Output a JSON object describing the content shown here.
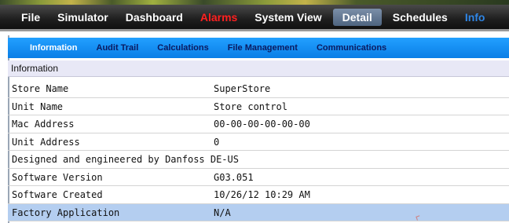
{
  "menu": {
    "items": [
      {
        "label": "File"
      },
      {
        "label": "Simulator"
      },
      {
        "label": "Dashboard"
      },
      {
        "label": "Alarms"
      },
      {
        "label": "System View"
      },
      {
        "label": "Detail"
      },
      {
        "label": "Schedules"
      },
      {
        "label": "Info"
      }
    ],
    "active": "Detail",
    "alarm_color": "#ff2020"
  },
  "subtabs": {
    "items": [
      {
        "label": "Information"
      },
      {
        "label": "Audit Trail"
      },
      {
        "label": "Calculations"
      },
      {
        "label": "File Management"
      },
      {
        "label": "Communications"
      }
    ],
    "active": "Information"
  },
  "section": {
    "title": "Information"
  },
  "rows": [
    {
      "label": "Store Name",
      "value": "SuperStore"
    },
    {
      "label": "Unit Name",
      "value": "Store control"
    },
    {
      "label": "Mac Address",
      "value": "00-00-00-00-00-00"
    },
    {
      "label": "Unit Address",
      "value": "0"
    },
    {
      "label": "Designed and engineered by Danfoss DE-US",
      "value": ""
    },
    {
      "label": "Software Version",
      "value": "G03.051"
    },
    {
      "label": "Software Created",
      "value": "10/26/12 10:29 AM"
    },
    {
      "label": "Factory Application",
      "value": "N/A"
    }
  ],
  "colors": {
    "subtab_bar": "#0a7ee6",
    "highlight_row": "#b4cef0",
    "section_header_bg": "#e8e8f6"
  }
}
